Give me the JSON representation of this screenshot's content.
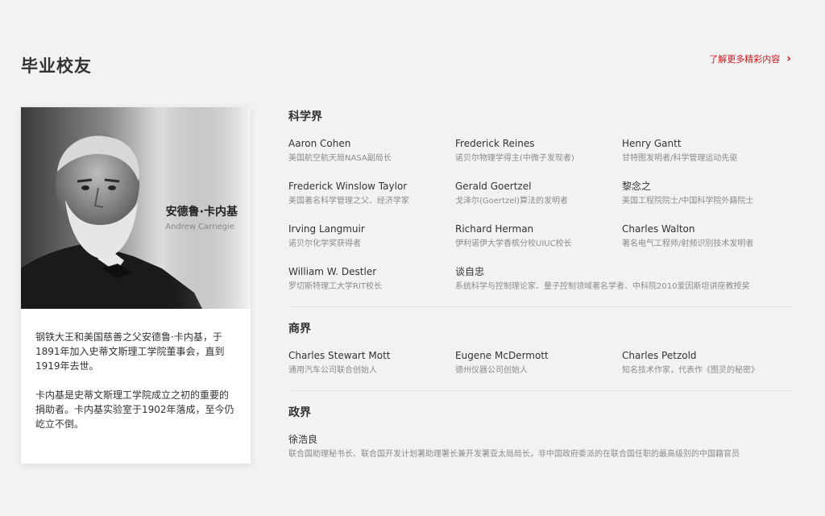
{
  "header": {
    "title": "毕业校友",
    "more_link": "了解更多精彩内容"
  },
  "card": {
    "name": "安德鲁·卡内基",
    "english_name": "Andrew Carnegie",
    "paragraphs": [
      "钢铁大王和美国慈善之父安德鲁·卡内基，于1891年加入史蒂文斯理工学院董事会，直到1919年去世。",
      "卡内基是史蒂文斯理工学院成立之初的重要的捐助者。卡内基实验室于1902年落成，至今仍屹立不倒。"
    ]
  },
  "sections": [
    {
      "title": "科学界",
      "people": [
        {
          "name": "Aaron Cohen",
          "desc": "美国航空航天局NASA副局长"
        },
        {
          "name": "Frederick Reines",
          "desc": "诺贝尔物理学得主(中微子发现者)"
        },
        {
          "name": "Henry Gantt",
          "desc": "甘特图发明者/科学管理运动先驱"
        },
        {
          "name": "Frederick Winslow Taylor",
          "desc": "美国著名科学管理之父、经济学家"
        },
        {
          "name": "Gerald Goertzel",
          "desc": "戈泽尔(Goertzel)算法的发明者"
        },
        {
          "name": "黎念之",
          "desc": "美国工程院院士/中国科学院外籍院士"
        },
        {
          "name": "Irving Langmuir",
          "desc": "诺贝尔化学奖获得者"
        },
        {
          "name": "Richard Herman",
          "desc": "伊利诺伊大学香槟分校UIUC校长"
        },
        {
          "name": "Charles Walton",
          "desc": "著名电气工程师/射频识别技术发明者"
        },
        {
          "name": "William W. Destler",
          "desc": "罗切斯特理工大学RIT校长"
        },
        {
          "name": "谈自忠",
          "desc": "系统科学与控制理论家、量子控制领域著名学者、中科院2010爱因斯坦讲座教授奖"
        }
      ]
    },
    {
      "title": "商界",
      "people": [
        {
          "name": "Charles Stewart Mott",
          "desc": "通用汽车公司联合创始人"
        },
        {
          "name": "Eugene McDermott",
          "desc": "德州仪器公司创始人"
        },
        {
          "name": "Charles Petzold",
          "desc": "知名技术作家，代表作《图灵的秘密》"
        }
      ]
    },
    {
      "title": "政界",
      "people": [
        {
          "name": "徐浩良",
          "desc": "联合国助理秘书长、联合国开发计划署助理署长兼开发署亚太局局长，非中国政府委派的在联合国任职的最高级别的中国籍官员"
        }
      ]
    }
  ],
  "colors": {
    "accent": "#c8161d",
    "background": "#f2f2f2",
    "card": "#ffffff"
  },
  "icons": {
    "more_link": "chevron-right-icon"
  }
}
